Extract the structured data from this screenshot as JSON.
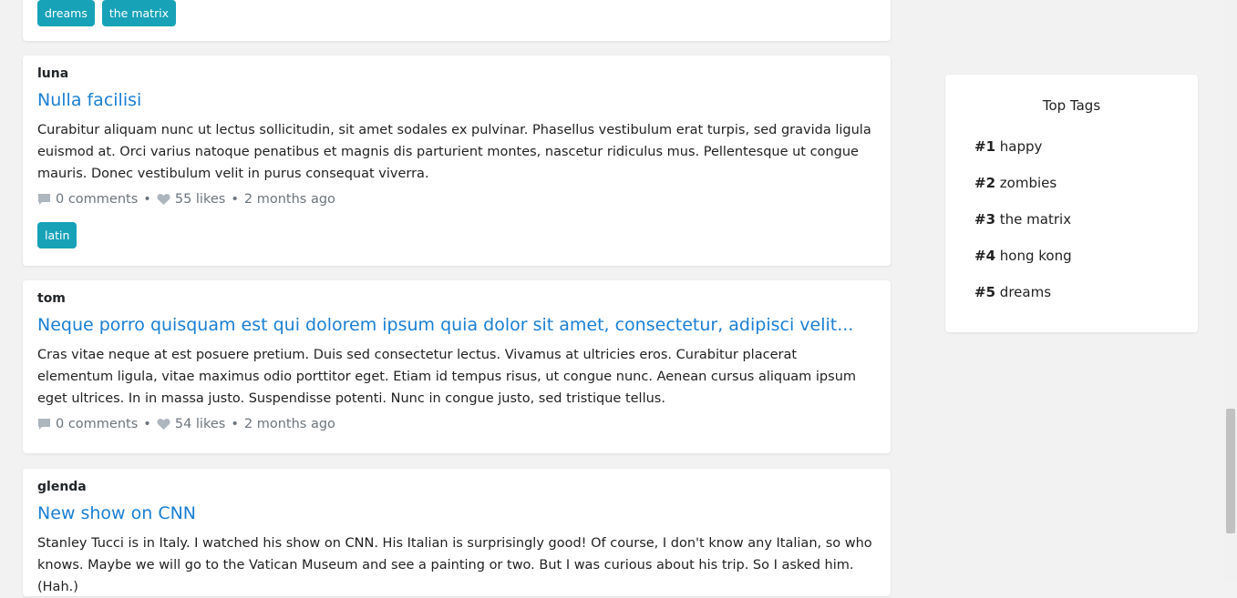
{
  "posts": [
    {
      "tags": [
        "dreams",
        "the matrix"
      ]
    },
    {
      "author": "luna",
      "title": "Nulla facilisi",
      "body": "Curabitur aliquam nunc ut lectus sollicitudin, sit amet sodales ex pulvinar. Phasellus vestibulum erat turpis, sed gravida ligula euismod at. Orci varius natoque penatibus et magnis dis parturient montes, nascetur ridiculus mus. Pellentesque ut congue mauris. Donec vestibulum velit in purus consequat viverra.",
      "comments": "0 comments",
      "likes": "55 likes",
      "time": "2 months ago",
      "tags": [
        "latin"
      ]
    },
    {
      "author": "tom",
      "title": "Neque porro quisquam est qui dolorem ipsum quia dolor sit amet, consectetur, adipisci velit...",
      "body": "Cras vitae neque at est posuere pretium. Duis sed consectetur lectus. Vivamus at ultricies eros. Curabitur placerat elementum ligula, vitae maximus odio porttitor eget. Etiam id tempus risus, ut congue nunc. Aenean cursus aliquam ipsum eget ultrices. In in massa justo. Suspendisse potenti. Nunc in congue justo, sed tristique tellus.",
      "comments": "0 comments",
      "likes": "54 likes",
      "time": "2 months ago"
    },
    {
      "author": "glenda",
      "title": "New show on CNN",
      "body": "Stanley Tucci is in Italy. I watched his show on CNN. His Italian is surprisingly good! Of course, I don't know any Italian, so who knows. Maybe we will go to the Vatican Museum and see a painting or two. But I was curious about his trip. So I asked him. (Hah.)"
    }
  ],
  "meta_separator": "•",
  "sidebar": {
    "title": "Top Tags",
    "tags": [
      {
        "rank": "#1",
        "name": "happy"
      },
      {
        "rank": "#2",
        "name": "zombies"
      },
      {
        "rank": "#3",
        "name": "the matrix"
      },
      {
        "rank": "#4",
        "name": "hong kong"
      },
      {
        "rank": "#5",
        "name": "dreams"
      }
    ]
  },
  "colors": {
    "accent": "#1a7fd4",
    "tag_bg": "#17a2b8",
    "muted": "#6c757d",
    "page_bg": "#f2f2f2"
  },
  "icons": {
    "comments": "comment-icon",
    "likes": "heart-icon"
  }
}
